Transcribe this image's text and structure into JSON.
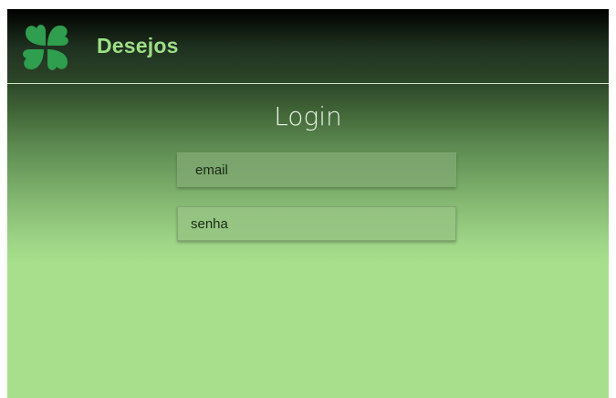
{
  "app": {
    "brand_name": "Desejos",
    "logo_icon": "four-leaf-clover-icon",
    "brand_color": "#9ddf86",
    "logo_color": "#2f9e4f"
  },
  "login": {
    "title": "Login",
    "email_placeholder": "email",
    "password_placeholder": "senha"
  }
}
